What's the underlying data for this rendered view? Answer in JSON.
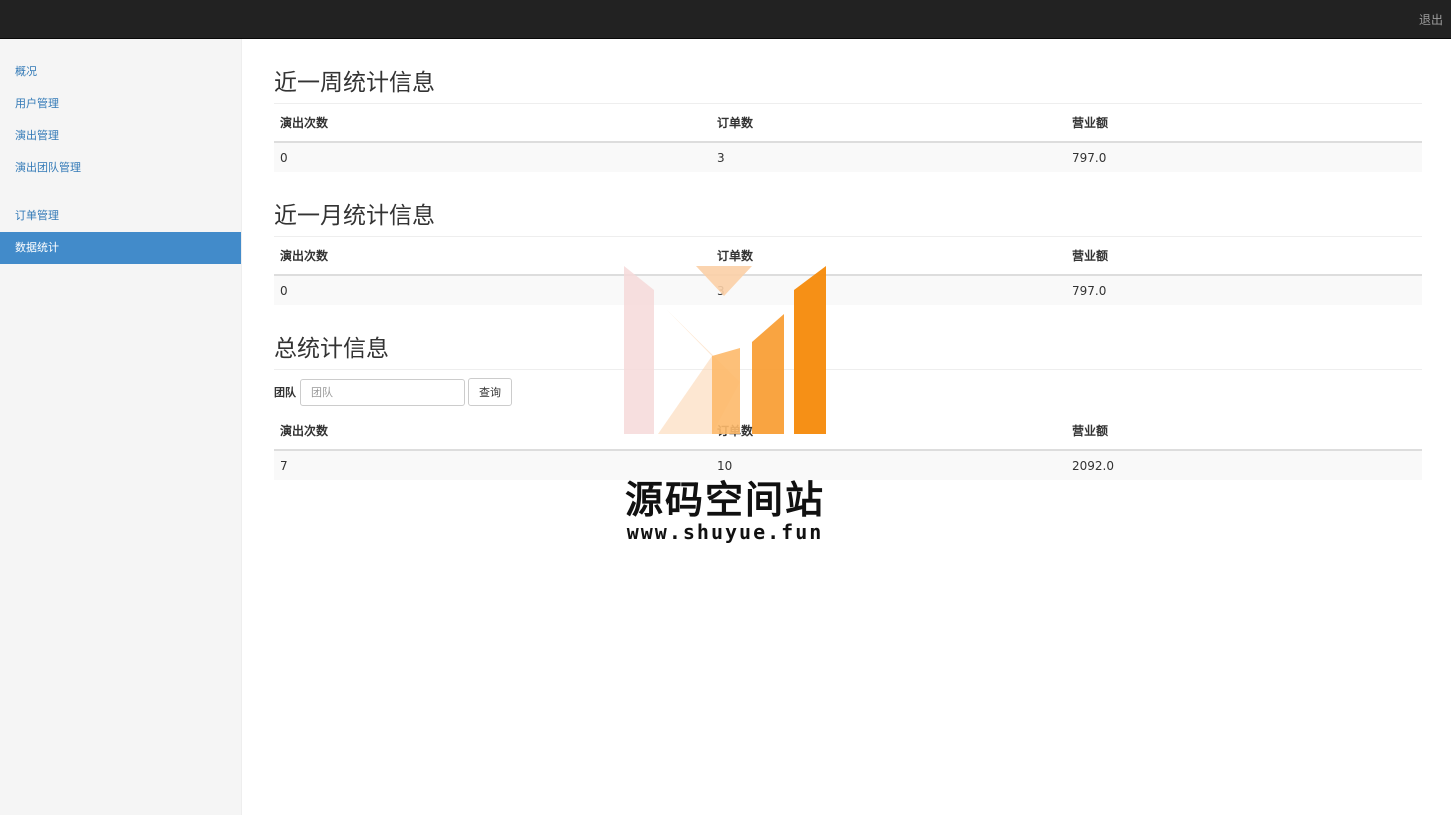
{
  "navbar": {
    "logout": "退出"
  },
  "sidebar": {
    "group1": [
      "概况",
      "用户管理",
      "演出管理",
      "演出团队管理"
    ],
    "group2": [
      "订单管理",
      "数据统计"
    ],
    "active": "数据统计"
  },
  "week": {
    "title": "近一周统计信息",
    "headers": [
      "演出次数",
      "订单数",
      "营业额"
    ],
    "row": [
      "0",
      "3",
      "797.0"
    ]
  },
  "month": {
    "title": "近一月统计信息",
    "headers": [
      "演出次数",
      "订单数",
      "营业额"
    ],
    "row": [
      "0",
      "3",
      "797.0"
    ]
  },
  "total": {
    "title": "总统计信息",
    "filter_label": "团队",
    "filter_placeholder": "团队",
    "query_button": "查询",
    "headers": [
      "演出次数",
      "订单数",
      "营业额"
    ],
    "row": [
      "7",
      "10",
      "2092.0"
    ]
  },
  "watermark": {
    "title": "源码空间站",
    "url": "www.shuyue.fun",
    "colors": [
      "#f6d9d9",
      "#fbcfa6",
      "#fdb96a",
      "#f89a2c",
      "#f68a0a"
    ]
  }
}
